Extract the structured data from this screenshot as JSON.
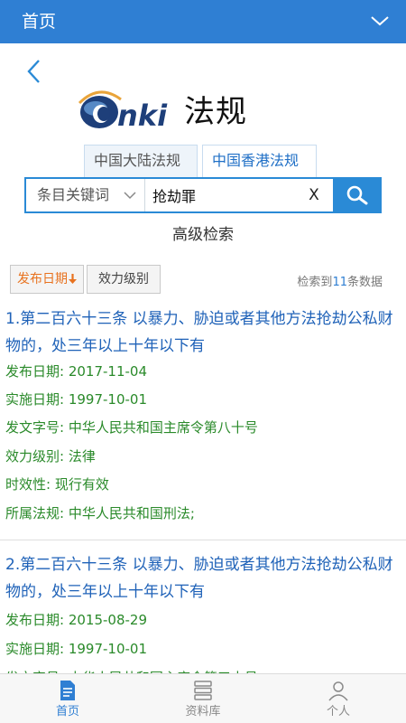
{
  "header": {
    "title": "首页"
  },
  "logo": {
    "brand": "CNKI",
    "word": "法规"
  },
  "tabs": [
    {
      "label": "中国大陆法规"
    },
    {
      "label": "中国香港法规"
    }
  ],
  "search": {
    "field_select": "条目关键词",
    "query": "抢劫罪",
    "clear_label": "X"
  },
  "advanced_search": "高级检索",
  "sort": {
    "by_date": "发布日期",
    "by_level": "效力级别"
  },
  "result_count": {
    "prefix": "检索到",
    "count": "11",
    "suffix": "条数据"
  },
  "results": [
    {
      "title": "1.第二百六十三条 以暴力、胁迫或者其他方法抢劫公私财物的，处三年以上十年以下有",
      "publish_date": "发布日期: 2017-11-04",
      "effective_date": "实施日期: 1997-10-01",
      "doc_number": "发文字号: 中华人民共和国主席令第八十号",
      "level": "效力级别: 法律",
      "validity": "时效性: 现行有效",
      "law": "所属法规: 中华人民共和国刑法;"
    },
    {
      "title": "2.第二百六十三条 以暴力、胁迫或者其他方法抢劫公私财物的，处三年以上十年以下有",
      "publish_date": "发布日期: 2015-08-29",
      "effective_date": "实施日期: 1997-10-01",
      "doc_number": "发文字号: 中华人民共和国主席令第三十号"
    }
  ],
  "bottom_nav": [
    {
      "label": "首页",
      "icon": "document-icon"
    },
    {
      "label": "资料库",
      "icon": "database-icon"
    },
    {
      "label": "个人",
      "icon": "person-icon"
    }
  ],
  "colors": {
    "header_bg": "#2f7fd3",
    "search_accent": "#2a8ad6",
    "result_title": "#1f62b8",
    "result_field": "#2a8a2a",
    "sort_active": "#e8721f"
  }
}
